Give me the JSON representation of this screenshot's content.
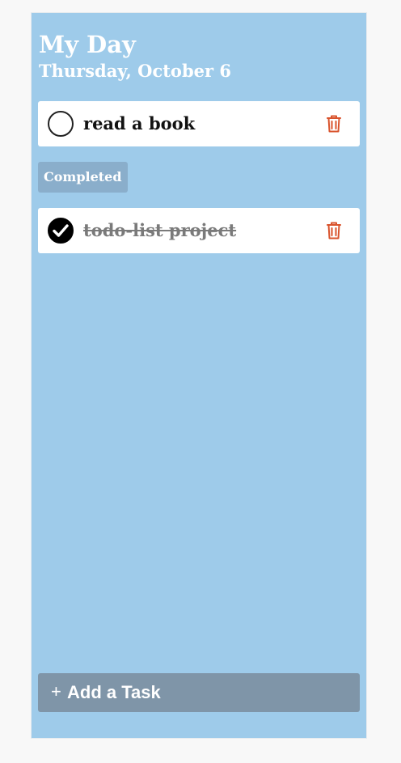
{
  "header": {
    "title": "My Day",
    "date": "Thursday, October 6"
  },
  "tasks": [
    {
      "label": "read a book",
      "completed": false,
      "check_icon": "empty-circle-icon",
      "delete_icon": "trash-icon"
    }
  ],
  "completed_section": {
    "label": "Completed",
    "tasks": [
      {
        "label": "todo-list project",
        "completed": true,
        "check_icon": "check-circle-icon",
        "delete_icon": "trash-icon"
      }
    ]
  },
  "add_task": {
    "icon": "+",
    "label": "Add a Task"
  },
  "colors": {
    "page_background": "#f8f8f8",
    "panel_background": "#9ecbea",
    "task_background": "#ffffff",
    "completed_badge": "#8aaecb",
    "add_task_button": "#7f95a8",
    "trash_icon": "#d9532c",
    "completed_text": "#7a7a7a"
  }
}
